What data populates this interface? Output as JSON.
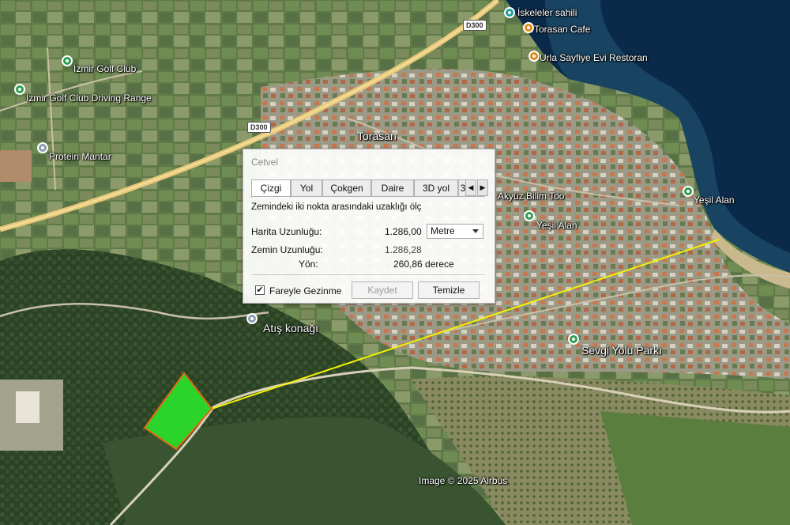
{
  "map": {
    "labels": {
      "iskeleler_sahili": "İskeleler sahili",
      "torasan_cafe": "Torasan Cafe",
      "sayfiye": "Urla Sayfiye Evi Restoran",
      "izmir_golf": "İzmir Golf Club",
      "golf_driving": "İzmir Golf Club Driving Range",
      "protein": "Protein Mantar",
      "torasan": "Torasan",
      "akyuz": "Akyüz Bilim Too",
      "yesil_alan_1": "Yeşil Alan",
      "yesil_alan_2": "Yeşil Alan",
      "atis_konagi": "Atış konağı",
      "sevgi_yolu": "Sevgi Yolu Parkı",
      "copyright": "Image © 2025 Airbus"
    },
    "road_badges": {
      "d300_top": "D300",
      "d300_mid": "D300"
    },
    "colors": {
      "measure_line": "#f5f200",
      "parcel_fill": "#2bd42b",
      "parcel_border": "#e06a10",
      "sea": "#0b2a4a"
    }
  },
  "dialog": {
    "title": "Cetvel",
    "tabs": [
      "Çizgi",
      "Yol",
      "Çokgen",
      "Daire",
      "3D yol",
      "3"
    ],
    "active_tab": "Çizgi",
    "description": "Zemindeki iki nokta arasındaki uzaklığı ölç",
    "map_length_label": "Harita Uzunluğu:",
    "map_length_value": "1.286,00",
    "unit": "Metre",
    "ground_length_label": "Zemin Uzunluğu:",
    "ground_length_value": "1.286,28",
    "heading_label": "Yön:",
    "heading_value": "260,86 derece",
    "mouse_nav_label": "Fareyle Gezinme",
    "mouse_nav_checked": "✔",
    "save_label": "Kaydet",
    "clear_label": "Temizle",
    "arrow_left": "◀",
    "arrow_right": "▶"
  }
}
